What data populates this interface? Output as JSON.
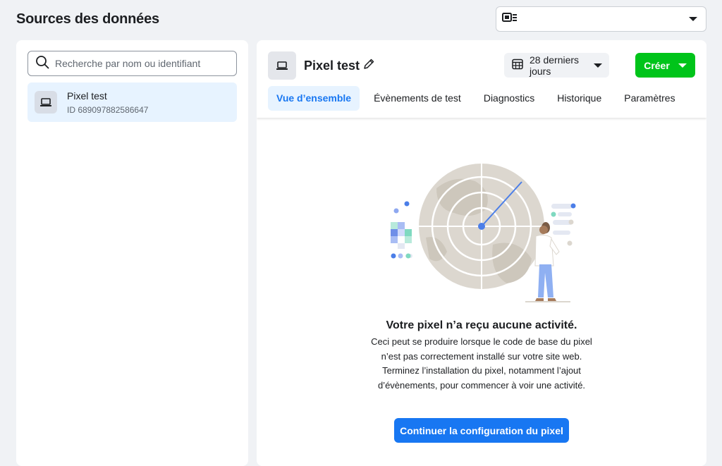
{
  "header": {
    "title": "Sources des données",
    "account_select": {
      "value": "",
      "icon": "business-card-icon"
    }
  },
  "sidebar": {
    "search": {
      "placeholder": "Recherche par nom ou identifiant",
      "value": ""
    },
    "items": [
      {
        "name": "Pixel test",
        "id_text": "ID 689097882586647",
        "icon": "laptop-icon",
        "selected": true
      }
    ]
  },
  "main": {
    "pixel_name": "Pixel test",
    "date_range": "28 derniers jours",
    "create_label": "Créer",
    "tabs": [
      {
        "label": "Vue d’ensemble",
        "active": true
      },
      {
        "label": "Évènements de test",
        "active": false
      },
      {
        "label": "Diagnostics",
        "active": false
      },
      {
        "label": "Historique",
        "active": false
      },
      {
        "label": "Paramètres",
        "active": false
      }
    ],
    "empty_state": {
      "title": "Votre pixel n’a reçu aucune activité.",
      "body": "Ceci peut se produire lorsque le code de base du pixel n’est pas correctement installé sur votre site web. Terminez l’installation du pixel, notamment l’ajout d’évènements, pour commencer à voir une activité.",
      "button_label": "Continuer la configuration du pixel"
    }
  },
  "colors": {
    "accent": "#1877f2",
    "create_button": "#00c41a",
    "selected_bg": "#e7f3ff",
    "page_bg": "#f0f2f5"
  }
}
